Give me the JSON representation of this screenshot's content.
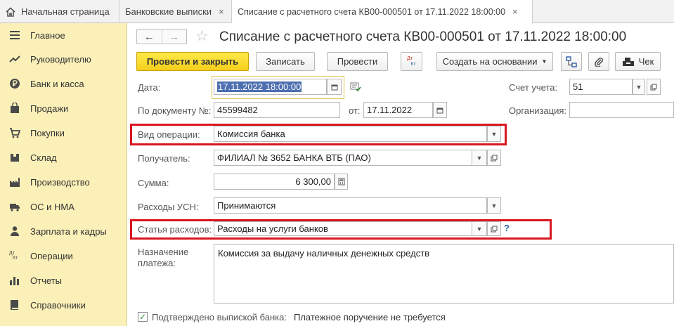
{
  "tabs": [
    {
      "label": "Начальная страница"
    },
    {
      "label": "Банковские выписки",
      "close": "×"
    },
    {
      "label": "Списание с расчетного счета КВ00-000501 от 17.11.2022 18:00:00",
      "close": "×"
    }
  ],
  "sidebar": {
    "items": [
      {
        "label": "Главное",
        "icon": "menu-icon"
      },
      {
        "label": "Руководителю",
        "icon": "trend-icon"
      },
      {
        "label": "Банк и касса",
        "icon": "ruble-icon"
      },
      {
        "label": "Продажи",
        "icon": "bag-icon"
      },
      {
        "label": "Покупки",
        "icon": "cart-icon"
      },
      {
        "label": "Склад",
        "icon": "box-icon"
      },
      {
        "label": "Производство",
        "icon": "factory-icon"
      },
      {
        "label": "ОС и НМА",
        "icon": "truck-icon"
      },
      {
        "label": "Зарплата и кадры",
        "icon": "person-icon"
      },
      {
        "label": "Операции",
        "icon": "dt-kt-icon",
        "glyph_top": "Дт",
        "glyph_bottom": "Кт"
      },
      {
        "label": "Отчеты",
        "icon": "bar-chart-icon"
      },
      {
        "label": "Справочники",
        "icon": "book-icon"
      }
    ]
  },
  "header": {
    "back": "←",
    "forward": "→",
    "star": "☆",
    "title": "Списание с расчетного счета КВ00-000501 от 17.11.2022 18:00:00"
  },
  "toolbar": {
    "post_close": "Провести и закрыть",
    "save": "Записать",
    "post": "Провести",
    "dtkt_top": "Дт",
    "dtkt_bottom": "Кт",
    "create_based": "Создать на основании",
    "check": "Чек"
  },
  "form": {
    "date_label": "Дата:",
    "date_value": "17.11.2022 18:00:00",
    "account_label": "Счет учета:",
    "account_value": "51",
    "doc_label": "По документу №:",
    "doc_value": "45599482",
    "from_label": "от:",
    "from_value": "17.11.2022",
    "org_label": "Организация:",
    "org_value": "",
    "op_label": "Вид операции:",
    "op_value": "Комиссия банка",
    "recipient_label": "Получатель:",
    "recipient_value": "ФИЛИАЛ № 3652 БАНКА ВТБ (ПАО)",
    "sum_label": "Сумма:",
    "sum_value": "6 300,00",
    "usn_label": "Расходы УСН:",
    "usn_value": "Принимаются",
    "expense_label": "Статья расходов:",
    "expense_value": "Расходы на услуги банков",
    "help": "?",
    "purpose_label_1": "Назначение",
    "purpose_label_2": "платежа:",
    "purpose_value": "Комиссия за выдачу наличных денежных средств",
    "confirmed_label": "Подтверждено выпиской банка:",
    "confirmed_checked": true,
    "confirmed_mark": "✓",
    "payment_order": "Платежное поручение не требуется"
  },
  "colors": {
    "sidebar_bg": "#fbf0b8",
    "primary_button": "#f5cf1a",
    "highlight_box": "#d9151f",
    "selection": "#4d6fb0"
  }
}
